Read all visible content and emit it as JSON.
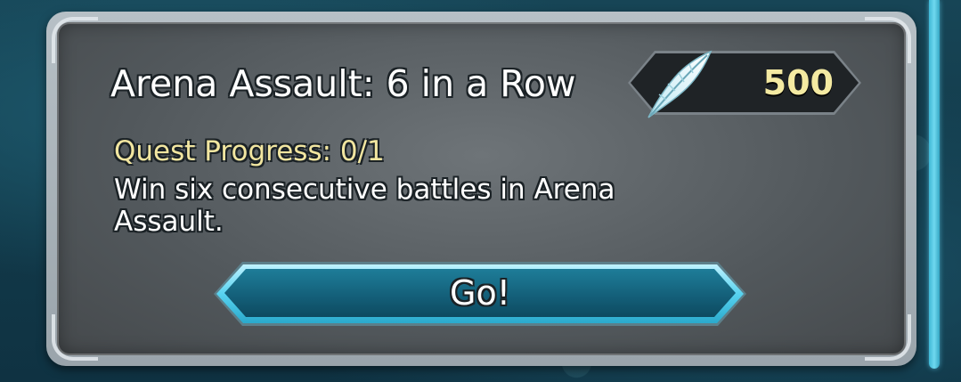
{
  "quest": {
    "title": "Arena Assault: 6 in a Row",
    "progress_text": "Quest Progress: 0/1",
    "description": "Win six consecutive battles in Arena Assault.",
    "progress": {
      "current": 0,
      "total": 1
    }
  },
  "reward": {
    "icon": "feather-icon",
    "value": "500"
  },
  "actions": {
    "go_label": "Go!"
  },
  "colors": {
    "progress_text": "#f2e6a0",
    "reward_value": "#f4eaa2",
    "button_accent": "#58d3f0",
    "scrollbar": "#3fb8d6"
  }
}
